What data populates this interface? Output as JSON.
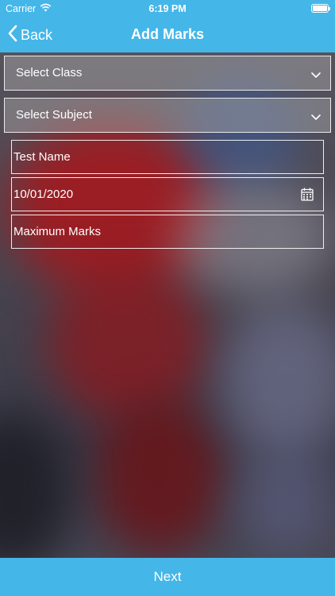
{
  "status_bar": {
    "carrier": "Carrier",
    "time": "6:19 PM",
    "wifi_icon": "wifi-icon",
    "battery_icon": "battery-icon"
  },
  "nav": {
    "back_label": "Back",
    "title": "Add Marks"
  },
  "form": {
    "class_select": "Select Class",
    "subject_select": "Select Subject",
    "test_name_placeholder": "Test Name",
    "date_value": "10/01/2020",
    "max_marks_placeholder": "Maximum Marks"
  },
  "footer": {
    "next_label": "Next"
  },
  "colors": {
    "accent": "#45b6e8"
  }
}
